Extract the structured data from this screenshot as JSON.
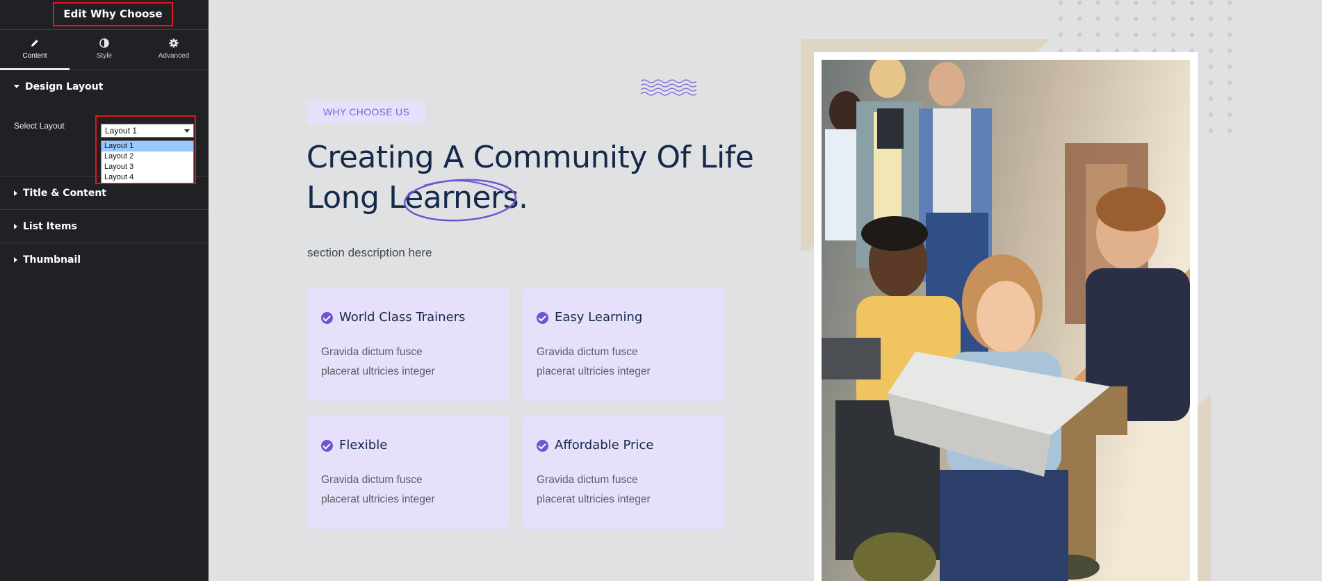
{
  "panel": {
    "title": "Edit Why Choose",
    "tabs": [
      {
        "label": "Content",
        "icon": "pencil-icon",
        "active": true
      },
      {
        "label": "Style",
        "icon": "half-circle-icon",
        "active": false
      },
      {
        "label": "Advanced",
        "icon": "gear-icon",
        "active": false
      }
    ],
    "sections": {
      "design_layout": "Design Layout",
      "title_content": "Title & Content",
      "list_items": "List Items",
      "thumbnail": "Thumbnail"
    },
    "select_layout": {
      "label": "Select Layout",
      "value": "Layout 1",
      "options": [
        "Layout 1",
        "Layout 2",
        "Layout 3",
        "Layout 4"
      ]
    },
    "collapse_glyph": "‹"
  },
  "preview": {
    "badge": "WHY CHOOSE US",
    "headline": {
      "line1": "Creating A Community Of Life",
      "line2": "Long Learners."
    },
    "description": "section description here",
    "cards": [
      {
        "title": "World Class Trainers",
        "text": "Gravida dictum fusce placerat ultricies integer"
      },
      {
        "title": "Easy Learning",
        "text": "Gravida dictum fusce placerat ultricies integer"
      },
      {
        "title": "Flexible",
        "text": "Gravida dictum fusce placerat ultricies integer"
      },
      {
        "title": "Affordable Price",
        "text": "Gravida dictum fusce placerat ultricies integer"
      }
    ]
  },
  "colors": {
    "accent": "#6e55d3",
    "heading": "#15294a",
    "card_bg": "#e6e0fb",
    "panel_bg": "#1f2124",
    "highlight_border": "#e3141b"
  }
}
